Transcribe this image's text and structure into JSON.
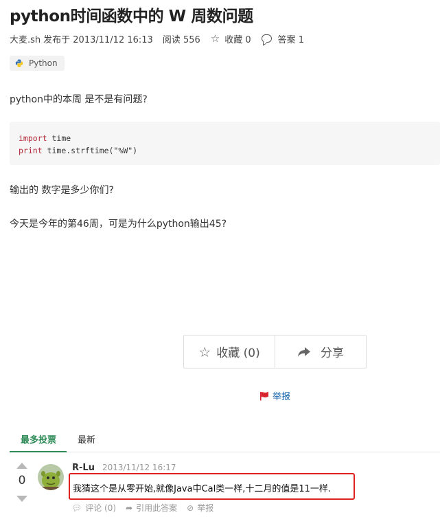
{
  "question": {
    "title": "python时间函数中的 W 周数问题",
    "author": "大麦.sh",
    "published": "发布于 2013/11/12 16:13",
    "views": "阅读 556",
    "favorites": "收藏 0",
    "answers": "答案 1",
    "tag": "Python",
    "paragraphs": [
      "python中的本周 是不是有问题?",
      "输出的 数字是多少你们?",
      "今天是今年的第46周，可是为什么python输出45?"
    ],
    "code": {
      "line1_keyword": "import",
      "line1_rest": " time",
      "line2_keyword": "print",
      "line2_rest": " time.strftime(\"%W\")"
    }
  },
  "actions": {
    "favorite_label": "收藏 (0)",
    "share_label": "分享",
    "report_label": "举报"
  },
  "tabs": [
    {
      "label": "最多投票",
      "active": true
    },
    {
      "label": "最新",
      "active": false
    }
  ],
  "answer": {
    "votes": "0",
    "author": "R-Lu",
    "time": "2013/11/12 16:17",
    "text": "我猜这个是从零开始,就像Java中Cal类一样,十二月的值是11一样.",
    "comment_label": "评论 (0)",
    "quote_label": "引用此答案",
    "report_label": "举报"
  },
  "colors": {
    "accent_green": "#2e8b57",
    "link_blue": "#0a5ea8",
    "highlight_red": "#e02020",
    "flag_red": "#d9232e"
  },
  "icons": [
    "star-icon",
    "comment-icon",
    "python-icon",
    "share-icon",
    "flag-icon",
    "upvote-icon",
    "downvote-icon",
    "quote-icon",
    "block-icon"
  ]
}
